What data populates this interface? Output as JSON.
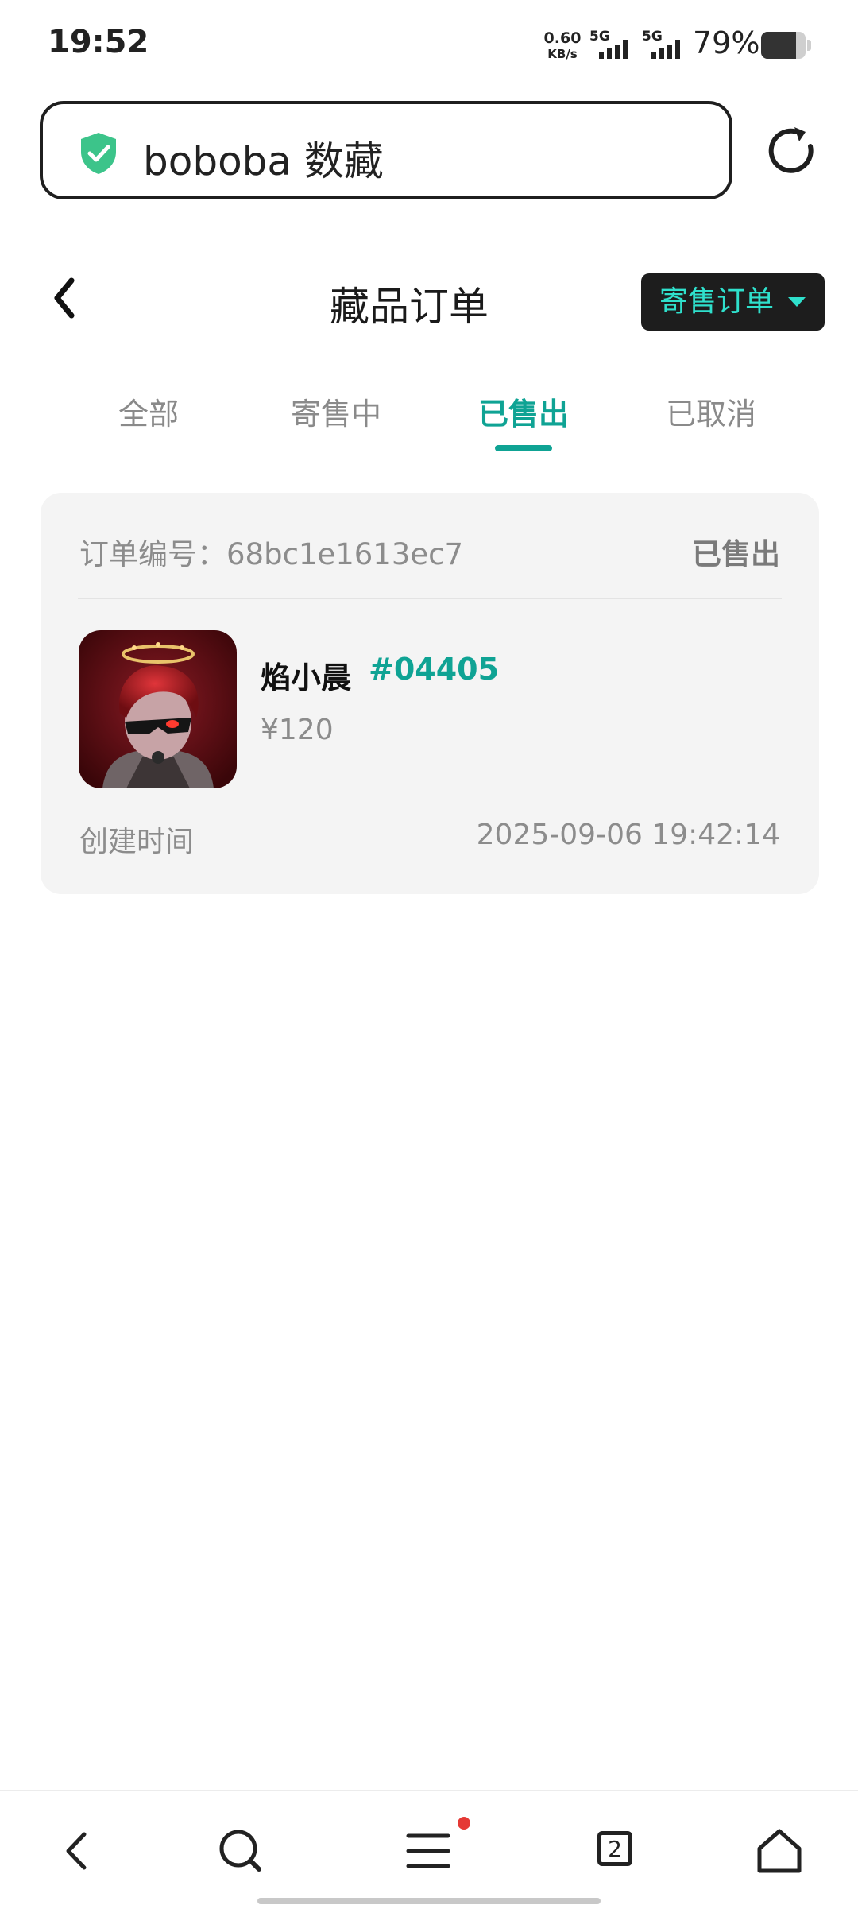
{
  "status_bar": {
    "time": "19:52",
    "net_speed": "0.60",
    "net_unit": "KB/s",
    "sim1_tag": "5G",
    "sim2_tag": "5G",
    "battery_percent": "79%",
    "battery_level": 0.79
  },
  "browser": {
    "url_text": "boboba 数藏",
    "secure_icon": "shield-check-icon",
    "reload_icon": "reload-icon",
    "accent_color": "#3cc48a"
  },
  "header": {
    "title": "藏品订单",
    "order_type_label": "寄售订单"
  },
  "tabs": [
    {
      "label": "全部"
    },
    {
      "label": "寄售中"
    },
    {
      "label": "已售出"
    },
    {
      "label": "已取消"
    }
  ],
  "active_tab_index": 2,
  "orders": [
    {
      "order_no": "订单编号：68bc1e1613ec7",
      "status": "已售出",
      "item_name": "焰小晨",
      "serial": "#04405",
      "price": "¥120",
      "created_label": "创建时间",
      "created_value": "2025-09-06 19:42:14"
    }
  ],
  "bottom_nav": {
    "icons": [
      "back-icon",
      "search-icon",
      "menu-icon",
      "tabs-icon",
      "home-icon"
    ],
    "tab_count": "2"
  },
  "colors": {
    "accent": "#0fa394",
    "order_type_text": "#2fe0cc",
    "order_type_bg": "#1d1d1d",
    "card_bg": "#f4f4f4"
  }
}
